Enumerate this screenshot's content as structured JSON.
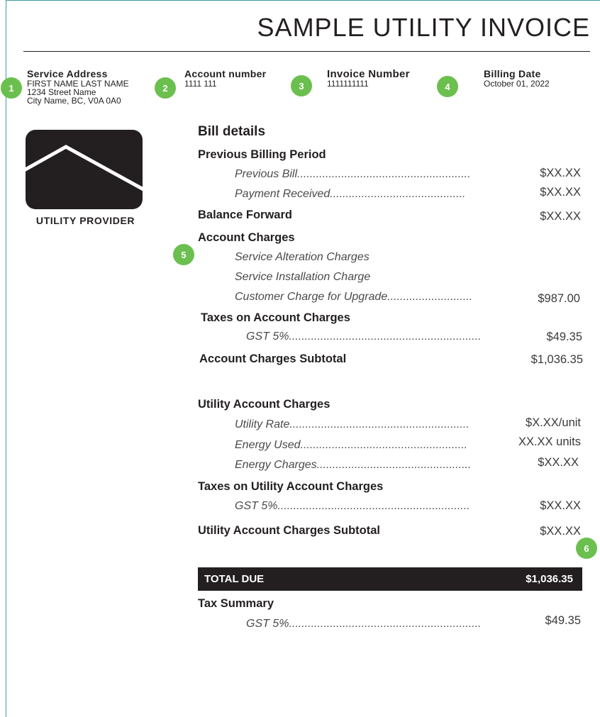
{
  "title": "SAMPLE UTILITY INVOICE",
  "header": {
    "service_address": {
      "label": "Service Address",
      "name": "FIRST NAME LAST NAME",
      "street": "1234 Street Name",
      "city": "City Name, BC, V0A 0A0"
    },
    "account_number": {
      "label": "Account number",
      "value": "1111 111"
    },
    "invoice_number": {
      "label": "Invoice Number",
      "value": "1111111111"
    },
    "billing_date": {
      "label": "Billing Date",
      "value": "October 01, 2022"
    }
  },
  "markers": [
    "1",
    "2",
    "3",
    "4",
    "5",
    "6"
  ],
  "provider": {
    "label": "UTILITY PROVIDER"
  },
  "bill": {
    "heading": "Bill details",
    "previous_period": "Previous Billing Period",
    "previous_bill": "Previous Bill.......................................................",
    "previous_bill_amt": "$XX.XX",
    "payment_received": "Payment Received...........................................",
    "payment_received_amt": "$XX.XX",
    "balance_forward": "Balance Forward",
    "balance_forward_amt": "$XX.XX",
    "account_charges": "Account Charges",
    "service_alteration": "Service Alteration Charges",
    "service_installation": "Service Installation Charge",
    "customer_upgrade": "Customer Charge for Upgrade...........................",
    "customer_upgrade_amt": "$987.00",
    "taxes_account": "Taxes on Account Charges",
    "gst_account": "GST 5%.............................................................",
    "gst_account_amt": "$49.35",
    "account_subtotal": "Account Charges Subtotal",
    "account_subtotal_amt": "$1,036.35",
    "utility_charges": "Utility Account Charges",
    "utility_rate": "Utility Rate.........................................................",
    "utility_rate_amt": "$X.XX/unit",
    "energy_used": "Energy Used.....................................................",
    "energy_used_amt": "XX.XX units",
    "energy_charges": "Energy Charges.................................................",
    "energy_charges_amt": "$XX.XX",
    "taxes_utility": "Taxes on Utility Account Charges",
    "gst_utility": "GST 5%.............................................................",
    "gst_utility_amt": "$XX.XX",
    "utility_subtotal": "Utility Account Charges Subtotal",
    "utility_subtotal_amt": "$XX.XX",
    "total_label": "TOTAL DUE",
    "total_amt": "$1,036.35",
    "tax_summary": "Tax Summary",
    "gst_summary": "GST 5%.............................................................",
    "gst_summary_amt": "$49.35"
  },
  "colors": {
    "accent": "#6bbf4e",
    "frame": "#3f9aa1",
    "dark": "#231f20"
  }
}
